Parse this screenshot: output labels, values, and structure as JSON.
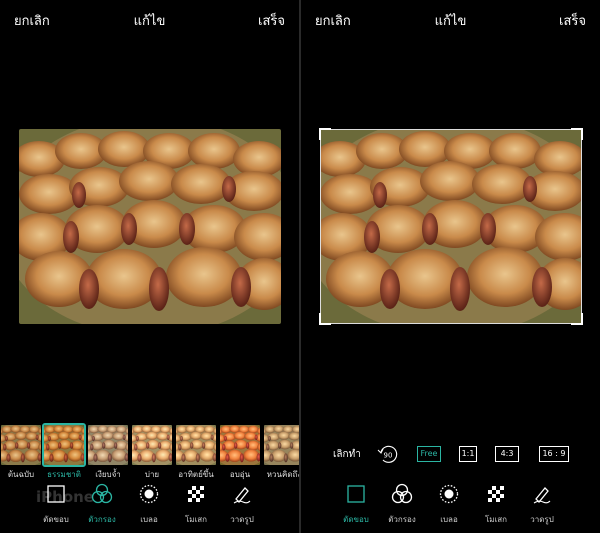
{
  "left": {
    "header": {
      "cancel": "ยกเลิก",
      "title": "แก้ไข",
      "done": "เสร็จ"
    },
    "filters": [
      {
        "label": "ต้นฉบับ",
        "selected": false
      },
      {
        "label": "ธรรมชาติ",
        "selected": true
      },
      {
        "label": "เงียบจ้ำ",
        "selected": false
      },
      {
        "label": "บ่าย",
        "selected": false
      },
      {
        "label": "อาทิตย์ขึ้น",
        "selected": false
      },
      {
        "label": "อบอุ่น",
        "selected": false
      },
      {
        "label": "หวนคิดถึง",
        "selected": false
      }
    ],
    "tools": [
      {
        "label": "ตัดขอบ",
        "icon": "crop-icon"
      },
      {
        "label": "ตัวกรอง",
        "icon": "filter-icon"
      },
      {
        "label": "เบลอ",
        "icon": "blur-icon"
      },
      {
        "label": "โมเสก",
        "icon": "mosaic-icon"
      },
      {
        "label": "วาดรูป",
        "icon": "draw-icon"
      }
    ],
    "watermark": "iPhone"
  },
  "right": {
    "header": {
      "cancel": "ยกเลิก",
      "title": "แก้ไข",
      "done": "เสร็จ"
    },
    "crop": {
      "undo": "เลิกทำ",
      "rotate": "90",
      "ratios": [
        "Free",
        "1:1",
        "4:3",
        "16 : 9"
      ]
    },
    "tools": [
      {
        "label": "ตัดขอบ",
        "icon": "crop-icon"
      },
      {
        "label": "ตัวกรอง",
        "icon": "filter-icon"
      },
      {
        "label": "เบลอ",
        "icon": "blur-icon"
      },
      {
        "label": "โมเสก",
        "icon": "mosaic-icon"
      },
      {
        "label": "วาดรูป",
        "icon": "draw-icon"
      }
    ]
  },
  "colors": {
    "accent": "#2bb5a3",
    "background": "#000000"
  }
}
